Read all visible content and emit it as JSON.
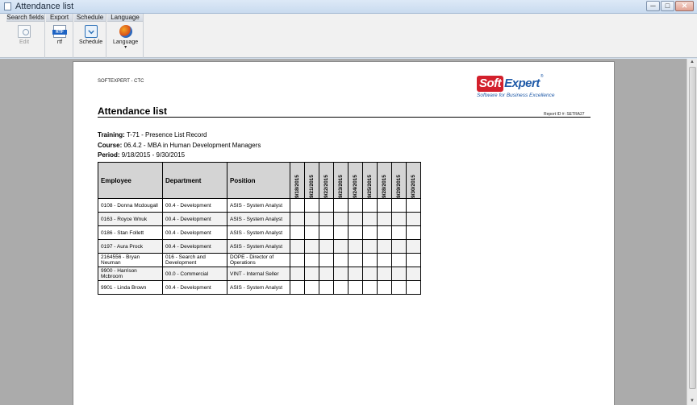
{
  "window": {
    "title": "Attendance list",
    "min": "─",
    "max": "□",
    "close": "✕"
  },
  "ribbon": {
    "groups": [
      {
        "header": "Search fields",
        "button": {
          "label": "Edit",
          "icon": "edit-icon"
        }
      },
      {
        "header": "Export",
        "button": {
          "label": "rtf",
          "icon": "rtf-icon",
          "badge": "RTF"
        }
      },
      {
        "header": "Schedule",
        "button": {
          "label": "Schedule",
          "icon": "schedule-icon"
        }
      },
      {
        "header": "Language",
        "button": {
          "label": "Language",
          "icon": "language-icon",
          "caret": "▾"
        }
      }
    ]
  },
  "report": {
    "company": "SOFTEXPERT - CTC",
    "logo": {
      "soft": "Soft",
      "expert": "Expert",
      "reg": "®",
      "tagline": "Software for Business Excellence"
    },
    "title": "Attendance list",
    "report_id": "Report ID #: SETRA27",
    "training_label": "Training:",
    "training_value": "T-71 - Presence List Record",
    "course_label": "Course:",
    "course_value": "06.4.2 - MBA in Human Development Managers",
    "period_label": "Period:",
    "period_value": "9/18/2015 - 9/30/2015",
    "columns": {
      "employee": "Employee",
      "department": "Department",
      "position": "Position"
    },
    "dates": [
      "9/18/2015",
      "9/21/2015",
      "9/22/2015",
      "9/23/2015",
      "9/24/2015",
      "9/25/2015",
      "9/28/2015",
      "9/29/2015",
      "9/30/2015"
    ],
    "rows": [
      {
        "employee": "0108 - Donna Mcdougall",
        "department": "00.4 - Development",
        "position": "ASIS - System Analyst"
      },
      {
        "employee": "0163 - Royce Wnuk",
        "department": "00.4 - Development",
        "position": "ASIS - System Analyst"
      },
      {
        "employee": "0186 - Stan Follett",
        "department": "00.4 - Development",
        "position": "ASIS - System Analyst"
      },
      {
        "employee": "0197 - Aura Prock",
        "department": "00.4 - Development",
        "position": "ASIS - System Analyst"
      },
      {
        "employee": "2164556 - Bryan Neuman",
        "department": "016 - Search and Development",
        "position": "DOPE - Director of Operations"
      },
      {
        "employee": "9900 - Harrison Mcbroom",
        "department": "00.0 - Commercial",
        "position": "VINT - Internal Seller"
      },
      {
        "employee": "9901 - Linda Brown",
        "department": "00.4 - Development",
        "position": "ASIS - System Analyst"
      }
    ]
  }
}
